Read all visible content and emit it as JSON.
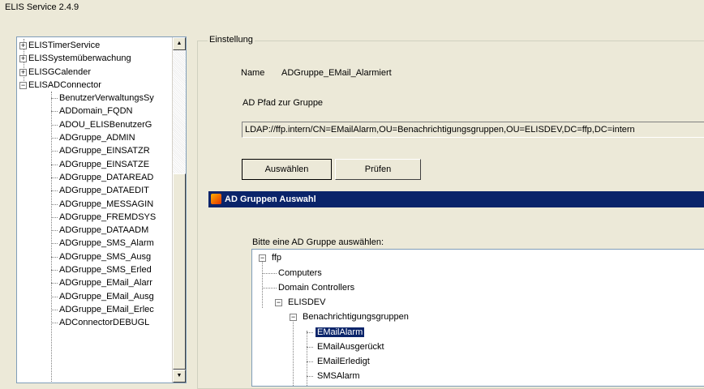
{
  "app": {
    "title": "ELIS Service 2.4.9"
  },
  "left_tree": {
    "roots": [
      {
        "label": "ELISTimerService",
        "expander": "+"
      },
      {
        "label": "ELISSystemüberwachung",
        "expander": "+"
      },
      {
        "label": "ELISGCalender",
        "expander": "+"
      },
      {
        "label": "ELISADConnector",
        "expander": "−"
      }
    ],
    "children": [
      "BenutzerVerwaltungsSy",
      "ADDomain_FQDN",
      "ADOU_ELISBenutzerG",
      "ADGruppe_ADMIN",
      "ADGruppe_EINSATZR",
      "ADGruppe_EINSATZE",
      "ADGruppe_DATAREAD",
      "ADGruppe_DATAEDIT",
      "ADGruppe_MESSAGIN",
      "ADGruppe_FREMDSYS",
      "ADGruppe_DATAADM",
      "ADGruppe_SMS_Alarm",
      "ADGruppe_SMS_Ausg",
      "ADGruppe_SMS_Erled",
      "ADGruppe_EMail_Alarr",
      "ADGruppe_EMail_Ausg",
      "ADGruppe_EMail_Erlec",
      "ADConnectorDEBUGL"
    ]
  },
  "settings": {
    "group_title": "Einstellung",
    "name_label": "Name",
    "name_value": "ADGruppe_EMail_Alarmiert",
    "path_label": "AD Pfad zur Gruppe",
    "path_value": "LDAP://ffp.intern/CN=EMailAlarm,OU=Benachrichtigungsgruppen,OU=ELISDEV,DC=ffp,DC=intern",
    "select_button": "Auswählen",
    "check_button": "Prüfen"
  },
  "dialog": {
    "title": "AD Gruppen Auswahl",
    "prompt": "Bitte eine AD Gruppe auswählen:",
    "tree": {
      "root": "ffp",
      "computers": "Computers",
      "domain_controllers": "Domain Controllers",
      "elisdev": "ELISDEV",
      "notif_groups": "Benachrichtigungsgruppen",
      "email_alarm": "EMailAlarm",
      "email_ausgerueckt": "EMailAusgerückt",
      "email_erledigt": "EMailErledigt",
      "sms_alarm": "SMSAlarm"
    }
  }
}
